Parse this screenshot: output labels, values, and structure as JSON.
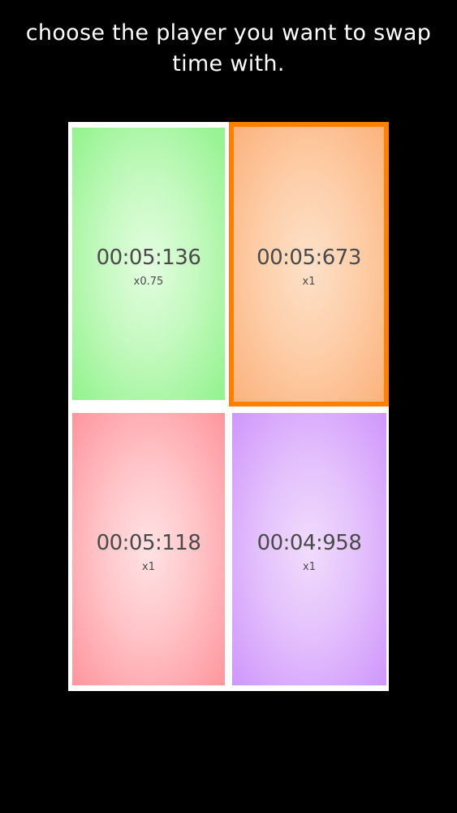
{
  "instruction": {
    "line1": "choose the player you want to swap",
    "line2": "time with."
  },
  "players": [
    {
      "time": "00:05:136",
      "multiplier": "x0.75",
      "color": "#91f38c",
      "selected": false
    },
    {
      "time": "00:05:673",
      "multiplier": "x1",
      "color": "#fcb27c",
      "selected": true,
      "highlight_color": "#ff8000"
    },
    {
      "time": "00:05:118",
      "multiplier": "x1",
      "color": "#ff959c",
      "selected": false
    },
    {
      "time": "00:04:958",
      "multiplier": "x1",
      "color": "#cf96fb",
      "selected": false
    }
  ]
}
